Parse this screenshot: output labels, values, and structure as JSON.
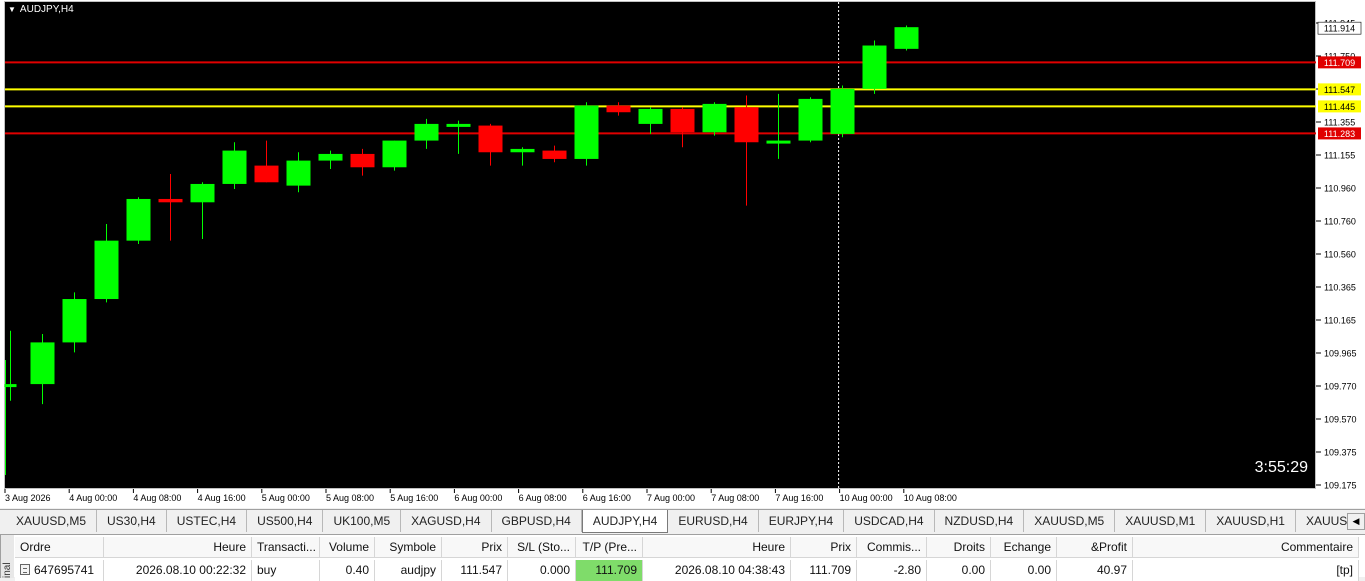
{
  "window": {
    "symbol_title": "AUDJPY,H4",
    "countdown": "3:55:29"
  },
  "chart_data": {
    "type": "candlestick",
    "y_labels": [
      "111.945",
      "111.750",
      "111.555",
      "111.355",
      "111.155",
      "110.960",
      "110.760",
      "110.560",
      "110.365",
      "110.165",
      "109.965",
      "109.770",
      "109.570",
      "109.375",
      "109.175"
    ],
    "x_labels": [
      "3 Aug 2026",
      "4 Aug 00:00",
      "4 Aug 08:00",
      "4 Aug 16:00",
      "5 Aug 00:00",
      "5 Aug 08:00",
      "5 Aug 16:00",
      "6 Aug 00:00",
      "6 Aug 08:00",
      "6 Aug 16:00",
      "7 Aug 00:00",
      "7 Aug 08:00",
      "7 Aug 16:00",
      "10 Aug 00:00",
      "10 Aug 08:00"
    ],
    "price_lines": [
      {
        "price": 111.914,
        "label": "111.914",
        "color": "#ffffff",
        "kind": "current"
      },
      {
        "price": 111.709,
        "label": "111.709",
        "color": "#e00000",
        "kind": "tp"
      },
      {
        "price": 111.547,
        "label": "111.547",
        "color": "#ffff00",
        "kind": "open"
      },
      {
        "price": 111.445,
        "label": "111.445",
        "color": "#ffff00",
        "kind": "level"
      },
      {
        "price": 111.283,
        "label": "111.283",
        "color": "#e00000",
        "kind": "level"
      }
    ],
    "candles": [
      {
        "o": 109.77,
        "h": 110.1,
        "l": 109.68,
        "c": 109.78
      },
      {
        "o": 109.78,
        "h": 110.08,
        "l": 109.66,
        "c": 110.03
      },
      {
        "o": 110.03,
        "h": 110.33,
        "l": 109.97,
        "c": 110.29
      },
      {
        "o": 110.29,
        "h": 110.74,
        "l": 110.27,
        "c": 110.64
      },
      {
        "o": 110.64,
        "h": 110.9,
        "l": 110.62,
        "c": 110.89
      },
      {
        "o": 110.89,
        "h": 111.04,
        "l": 110.64,
        "c": 110.87
      },
      {
        "o": 110.87,
        "h": 110.99,
        "l": 110.65,
        "c": 110.98
      },
      {
        "o": 110.98,
        "h": 111.23,
        "l": 110.95,
        "c": 111.18
      },
      {
        "o": 111.09,
        "h": 111.24,
        "l": 110.99,
        "c": 110.99
      },
      {
        "o": 110.97,
        "h": 111.17,
        "l": 110.93,
        "c": 111.12
      },
      {
        "o": 111.12,
        "h": 111.18,
        "l": 111.07,
        "c": 111.16
      },
      {
        "o": 111.16,
        "h": 111.19,
        "l": 111.03,
        "c": 111.08
      },
      {
        "o": 111.08,
        "h": 111.24,
        "l": 111.06,
        "c": 111.24
      },
      {
        "o": 111.24,
        "h": 111.37,
        "l": 111.19,
        "c": 111.34
      },
      {
        "o": 111.33,
        "h": 111.36,
        "l": 111.16,
        "c": 111.34
      },
      {
        "o": 111.33,
        "h": 111.34,
        "l": 111.09,
        "c": 111.17
      },
      {
        "o": 111.17,
        "h": 111.2,
        "l": 111.09,
        "c": 111.19
      },
      {
        "o": 111.18,
        "h": 111.21,
        "l": 111.11,
        "c": 111.13
      },
      {
        "o": 111.13,
        "h": 111.47,
        "l": 111.09,
        "c": 111.45
      },
      {
        "o": 111.45,
        "h": 111.47,
        "l": 111.39,
        "c": 111.41
      },
      {
        "o": 111.34,
        "h": 111.44,
        "l": 111.28,
        "c": 111.43
      },
      {
        "o": 111.43,
        "h": 111.44,
        "l": 111.2,
        "c": 111.29
      },
      {
        "o": 111.29,
        "h": 111.47,
        "l": 111.27,
        "c": 111.46
      },
      {
        "o": 111.44,
        "h": 111.51,
        "l": 110.85,
        "c": 111.23
      },
      {
        "o": 111.24,
        "h": 111.52,
        "l": 111.13,
        "c": 111.24
      },
      {
        "o": 111.24,
        "h": 111.5,
        "l": 111.23,
        "c": 111.49
      },
      {
        "o": 111.28,
        "h": 111.57,
        "l": 111.26,
        "c": 111.55
      },
      {
        "o": 111.55,
        "h": 111.84,
        "l": 111.52,
        "c": 111.81
      },
      {
        "o": 111.79,
        "h": 111.93,
        "l": 111.78,
        "c": 111.92
      }
    ],
    "bull_color": "#00ff00",
    "bear_color": "#ff0000",
    "crosshair_x_label": "10 Aug 00:00"
  },
  "tabs": [
    {
      "label": "XAUUSD,M5"
    },
    {
      "label": "US30,H4"
    },
    {
      "label": "USTEC,H4"
    },
    {
      "label": "US500,H4"
    },
    {
      "label": "UK100,M5"
    },
    {
      "label": "XAGUSD,H4"
    },
    {
      "label": "GBPUSD,H4"
    },
    {
      "label": "AUDJPY,H4",
      "active": true
    },
    {
      "label": "EURUSD,H4"
    },
    {
      "label": "EURJPY,H4"
    },
    {
      "label": "USDCAD,H4"
    },
    {
      "label": "NZDUSD,H4"
    },
    {
      "label": "XAUUSD,M5"
    },
    {
      "label": "XAUUSD,M1"
    },
    {
      "label": "XAUUSD,H1"
    },
    {
      "label": "XAUUSD,Weekl"
    }
  ],
  "terminal": {
    "side_label": "inal",
    "columns": [
      "Ordre",
      "Heure",
      "Transacti...",
      "Volume",
      "Symbole",
      "Prix",
      "S/L (Sto...",
      "T/P (Pre...",
      "Heure",
      "Prix",
      "Commis...",
      "Droits",
      "Echange",
      "&Profit",
      "Commentaire"
    ],
    "row": [
      "647695741",
      "2026.08.10 00:22:32",
      "buy",
      "0.40",
      "audjpy",
      "111.547",
      "0.000",
      "111.709",
      "2026.08.10 04:38:43",
      "111.709",
      "-2.80",
      "0.00",
      "0.00",
      "40.97",
      "[tp]"
    ]
  }
}
